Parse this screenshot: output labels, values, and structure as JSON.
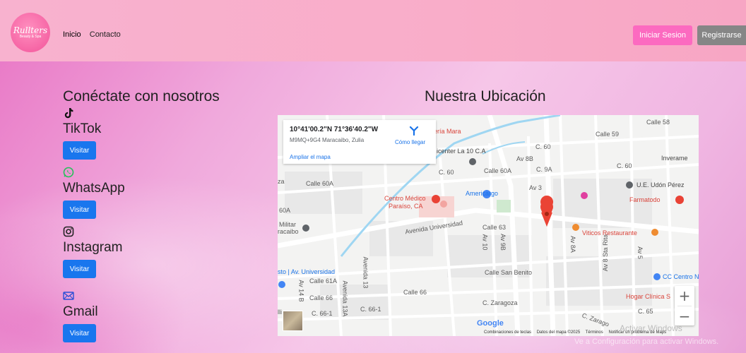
{
  "navbar": {
    "logo_text": "Rullters",
    "logo_sub": "Beauty & Spa",
    "links": [
      {
        "label": "Inicio"
      },
      {
        "label": "Contacto"
      }
    ],
    "login_label": "Iniciar Sesion",
    "register_label": "Registrarse"
  },
  "contact": {
    "title": "Conéctate con nosotros",
    "socials": [
      {
        "name": "TikTok",
        "button": "Visitar",
        "icon": "tiktok-icon"
      },
      {
        "name": "WhatsApp",
        "button": "Visitar",
        "icon": "whatsapp-icon"
      },
      {
        "name": "Instagram",
        "button": "Visitar",
        "icon": "instagram-icon"
      },
      {
        "name": "Gmail",
        "button": "Visitar",
        "icon": "mail-icon"
      }
    ]
  },
  "location": {
    "title": "Nuestra Ubicación",
    "card": {
      "coords": "10°41'00.2\"N 71°36'40.2\"W",
      "plus_code": "M9MQ+9G4 Maracaibo, Zulia",
      "directions": "Cómo llegar",
      "enlarge": "Ampliar el mapa"
    },
    "labels": {
      "panaderia": "adería Mara",
      "centro_la10": "icenter La 10 C.A",
      "calle59": "Calle 59",
      "calle58": "Calle 58",
      "c60a": "C. 60",
      "c60b": "C. 60",
      "c60c": "C. 60",
      "calle60a": "Calle 60A",
      "calle60a2": "Calle 60A",
      "c60a_left": "60A",
      "av8b": "Av 8B",
      "av9a": "C. 9A",
      "av3": "Av 3",
      "inverame": "Inverame",
      "udon": "U.E. Udón Pérez",
      "farmatodo": "Farmatodo",
      "americargo": "Americargo",
      "centro_medico": "Centro Médico",
      "paraiso": "Paraíso, CA",
      "av_univ": "Avenida Universidad",
      "calle63": "Calle 63",
      "av10": "Av 10",
      "av9b": "Av 9B",
      "av8a": "Av 8A",
      "av8sta": "Av 8 Sta Rita",
      "av5": "Av 5",
      "militar": "Militar",
      "racaibo": "racaibo",
      "viticos": "Viticos Restaurante",
      "sto_univ": "sto | Av. Universidad",
      "calle61a": "Calle 61A",
      "av14b": "Av 14 B",
      "av13": "Avenida 13",
      "calle66a": "Calle 66",
      "calle66b": "Calle 66",
      "calle_san_benito": "Calle San Benito",
      "cc_centro": "CC Centro N",
      "c_zaragoza": "C. Zaragoza",
      "hogar": "Hogar Clínica S",
      "c65": "C. 65",
      "c66_1a": "C. 66-1",
      "c66_1b": "C. 66-1",
      "av13a": "Avenida 13A",
      "zaragoza2": "C. Zarago",
      "za": "za",
      "ll": "lli"
    },
    "attribution": [
      "Combinaciones de teclas",
      "Datos del mapa ©2025",
      "Términos",
      "Notificar un problema de Maps"
    ],
    "google": "Google"
  },
  "os_watermark": {
    "line1": "Activar Windows",
    "line2": "Ve a Configuración para activar Windows."
  }
}
